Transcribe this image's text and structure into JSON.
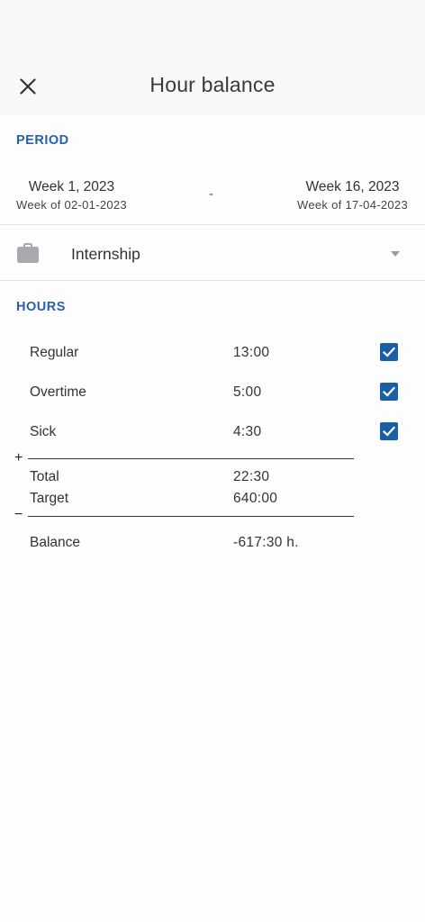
{
  "header": {
    "title": "Hour balance",
    "close_icon": "close-icon"
  },
  "period": {
    "label": "PERIOD",
    "start": {
      "week": "Week 1, 2023",
      "week_of": "Week of 02-01-2023"
    },
    "separator": "-",
    "end": {
      "week": "Week 16, 2023",
      "week_of": "Week of 17-04-2023"
    }
  },
  "project": {
    "icon": "briefcase-icon",
    "label": "Internship"
  },
  "hours": {
    "label": "HOURS",
    "rows": [
      {
        "label": "Regular",
        "value": "13:00",
        "checked": true
      },
      {
        "label": "Overtime",
        "value": "5:00",
        "checked": true
      },
      {
        "label": "Sick",
        "value": "4:30",
        "checked": true
      }
    ],
    "plus_sign": "+",
    "total": {
      "label": "Total",
      "value": "22:30"
    },
    "target": {
      "label": "Target",
      "value": "640:00"
    },
    "minus_sign": "−",
    "balance": {
      "label": "Balance",
      "value": "-617:30 h."
    }
  },
  "colors": {
    "accent": "#2b5fad",
    "checkbox": "#1a5fa5",
    "header_bg": "#f8f8fa"
  }
}
